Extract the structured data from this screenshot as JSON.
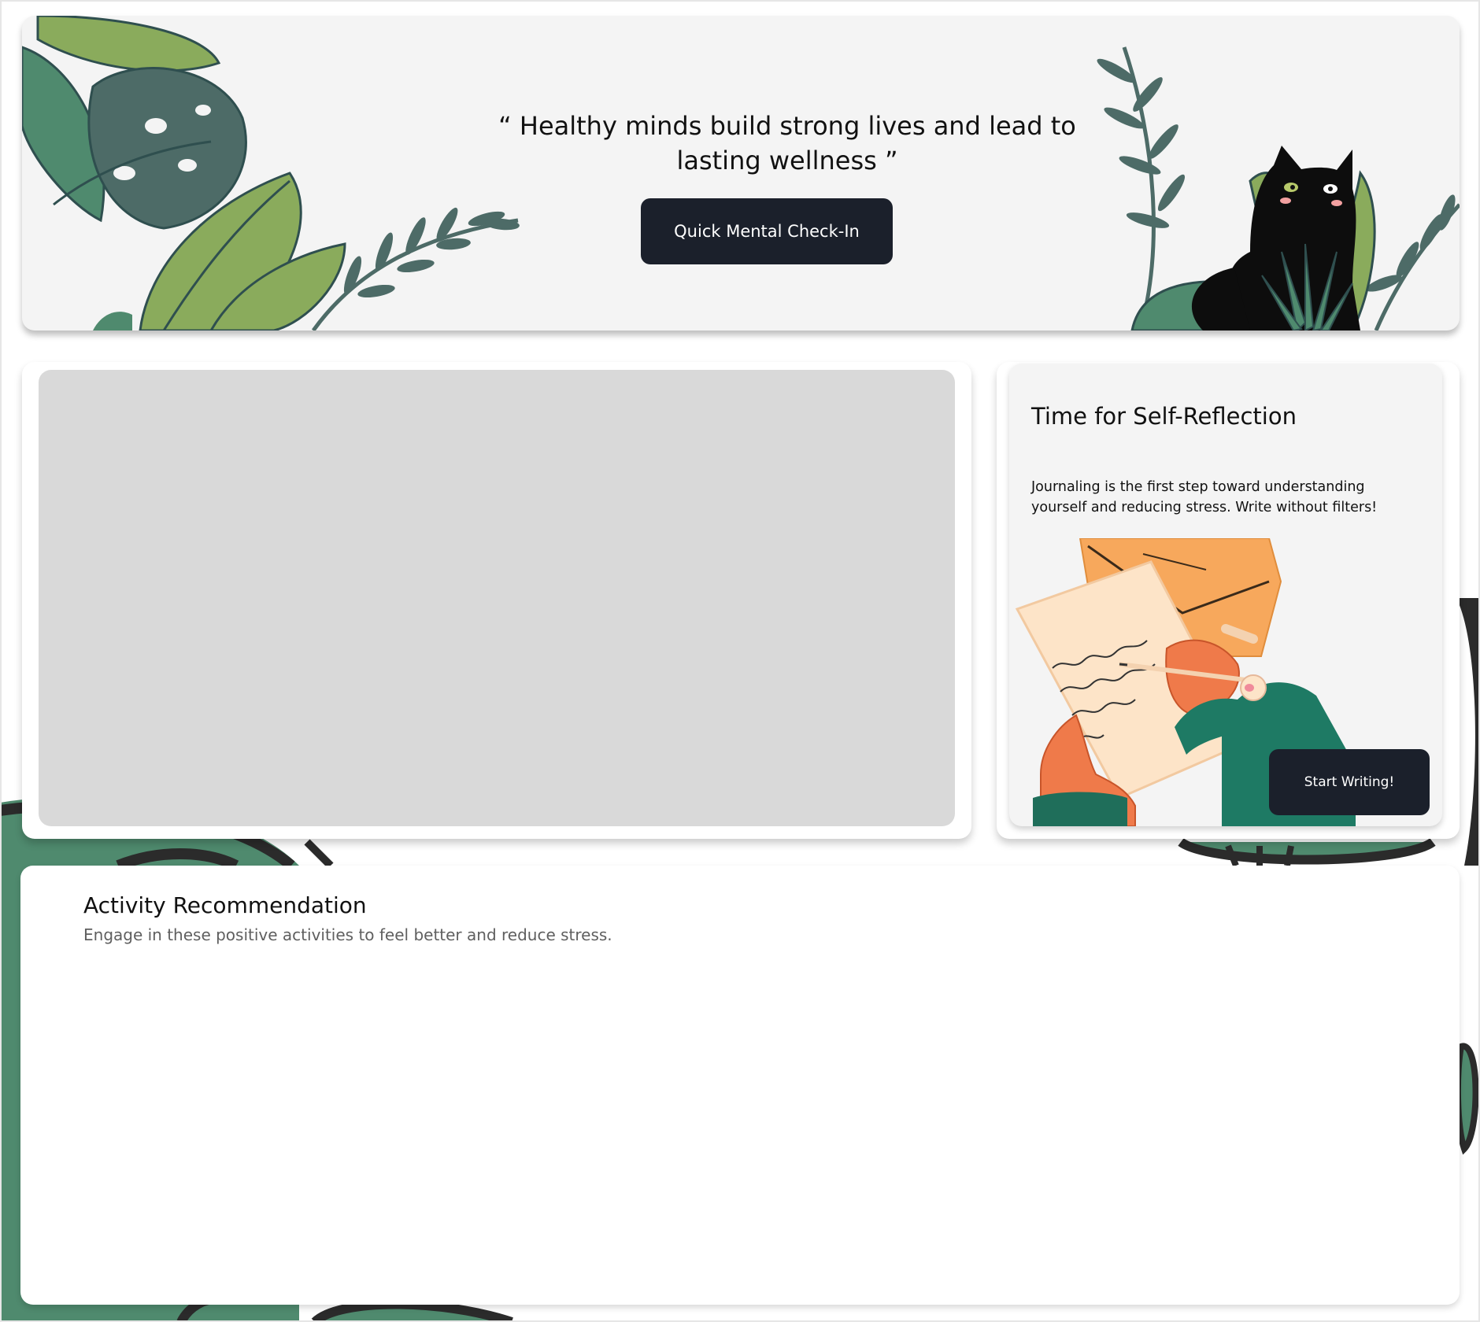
{
  "hero": {
    "quote": "“ Healthy minds build strong lives and lead to lasting wellness ”",
    "checkin_label": "Quick Mental Check-In"
  },
  "journal": {
    "title": "Time for Self-Reflection",
    "description": "Journaling is the first step toward understanding yourself and reducing stress. Write without filters!",
    "button_label": "Start Writing!"
  },
  "activity": {
    "title": "Activity Recommendation",
    "subtitle": "Engage in these positive activities to feel better and reduce stress."
  },
  "colors": {
    "button_dark": "#1b202b",
    "banner_bg": "#f4f4f4",
    "leaf_green": "#4f8a6e",
    "leaf_light": "#8aab5c",
    "placeholder": "#d9d9d9"
  }
}
